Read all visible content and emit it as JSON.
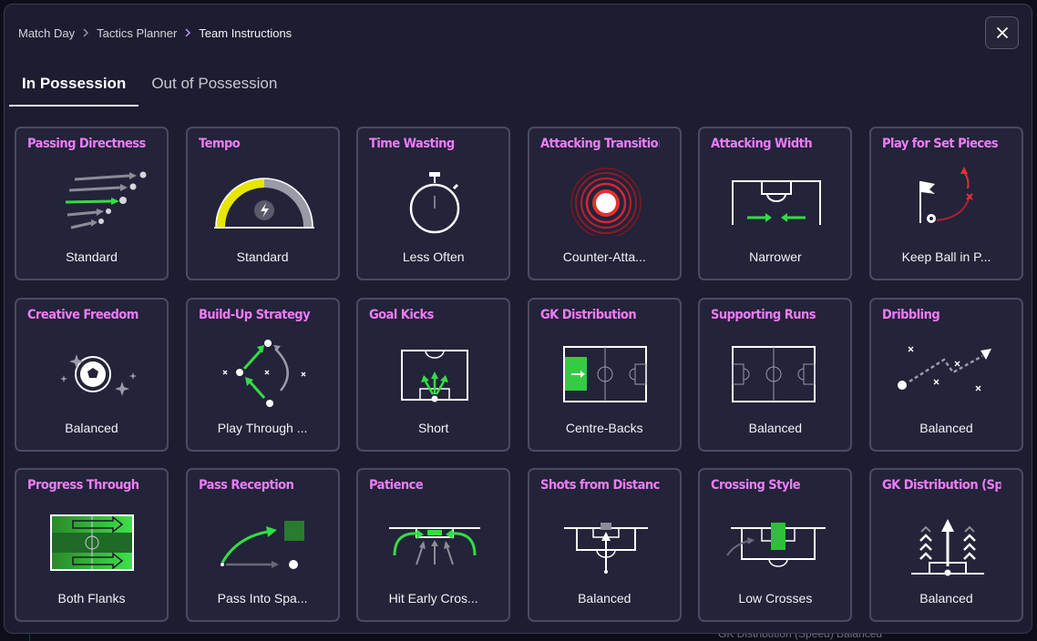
{
  "breadcrumb": {
    "items": [
      "Match Day",
      "Tactics Planner"
    ],
    "current": "Team Instructions"
  },
  "tabs": [
    {
      "label": "In Possession",
      "active": true
    },
    {
      "label": "Out of Possession",
      "active": false
    }
  ],
  "cards": [
    {
      "title": "Passing Directness",
      "value": "Standard",
      "icon": "passing-directness-icon"
    },
    {
      "title": "Tempo",
      "value": "Standard",
      "icon": "tempo-gauge-icon"
    },
    {
      "title": "Time Wasting",
      "value": "Less Often",
      "icon": "stopwatch-icon"
    },
    {
      "title": "Attacking Transition",
      "value": "Counter-Atta...",
      "icon": "target-rings-icon"
    },
    {
      "title": "Attacking Width",
      "value": "Narrower",
      "icon": "attacking-width-icon"
    },
    {
      "title": "Play for Set Pieces",
      "value": "Keep Ball in P...",
      "icon": "corner-flag-icon"
    },
    {
      "title": "Creative Freedom",
      "value": "Balanced",
      "icon": "ball-sparkle-icon"
    },
    {
      "title": "Build-Up Strategy",
      "value": "Play Through ...",
      "icon": "build-up-icon"
    },
    {
      "title": "Goal Kicks",
      "value": "Short",
      "icon": "goal-kick-icon"
    },
    {
      "title": "GK Distribution",
      "value": "Centre-Backs",
      "icon": "gk-distribution-pitch-icon"
    },
    {
      "title": "Supporting Runs",
      "value": "Balanced",
      "icon": "supporting-runs-pitch-icon"
    },
    {
      "title": "Dribbling",
      "value": "Balanced",
      "icon": "dribbling-icon"
    },
    {
      "title": "Progress Through",
      "value": "Both Flanks",
      "icon": "progress-flanks-icon"
    },
    {
      "title": "Pass Reception",
      "value": "Pass Into Spa...",
      "icon": "pass-reception-icon"
    },
    {
      "title": "Patience",
      "value": "Hit Early Cros...",
      "icon": "patience-icon"
    },
    {
      "title": "Shots from Distance",
      "value": "Balanced",
      "icon": "shots-distance-icon"
    },
    {
      "title": "Crossing Style",
      "value": "Low Crosses",
      "icon": "crossing-style-icon"
    },
    {
      "title": "GK Distribution (Speed)",
      "value": "Balanced",
      "icon": "gk-speed-icon"
    }
  ],
  "background_footer": "GK Distribution (Speed)  Balanced",
  "colors": {
    "title": "#ee7cf6",
    "accent_green": "#33dd44",
    "gauge_yellow": "#e6e600",
    "danger_red": "#e23030",
    "panel": "#1d1d31",
    "card": "#23233a"
  }
}
